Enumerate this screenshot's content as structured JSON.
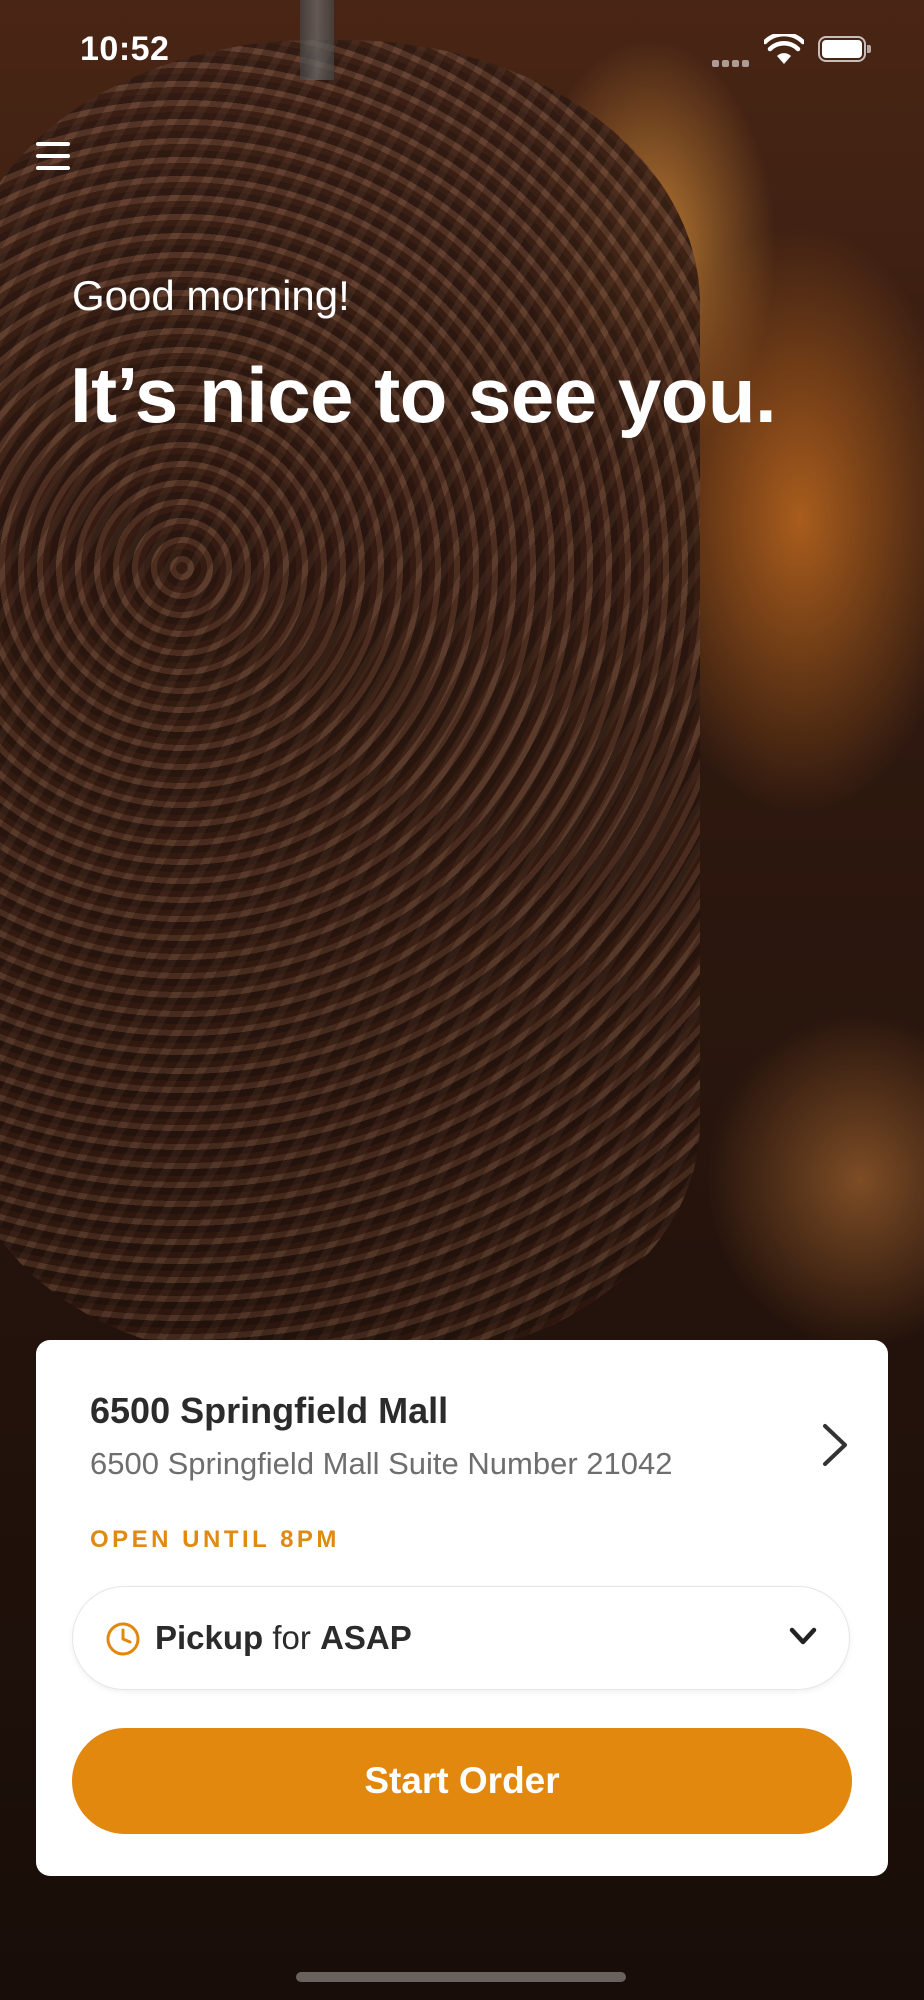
{
  "status_bar": {
    "time": "10:52"
  },
  "hero": {
    "greeting": "Good morning!",
    "headline": "It’s nice to see you."
  },
  "store": {
    "name": "6500 Springfield Mall",
    "address": "6500 Springfield Mall Suite Number 21042",
    "open_status": "OPEN UNTIL 8PM"
  },
  "order_mode": {
    "mode": "Pickup",
    "connector": "for",
    "time": "ASAP"
  },
  "actions": {
    "start_order": "Start Order"
  },
  "colors": {
    "accent": "#e2880f",
    "open_status": "#e08a12"
  },
  "icons": [
    "menu-icon",
    "wifi-icon",
    "battery-icon",
    "chevron-right-icon",
    "clock-icon",
    "chevron-down-icon"
  ]
}
